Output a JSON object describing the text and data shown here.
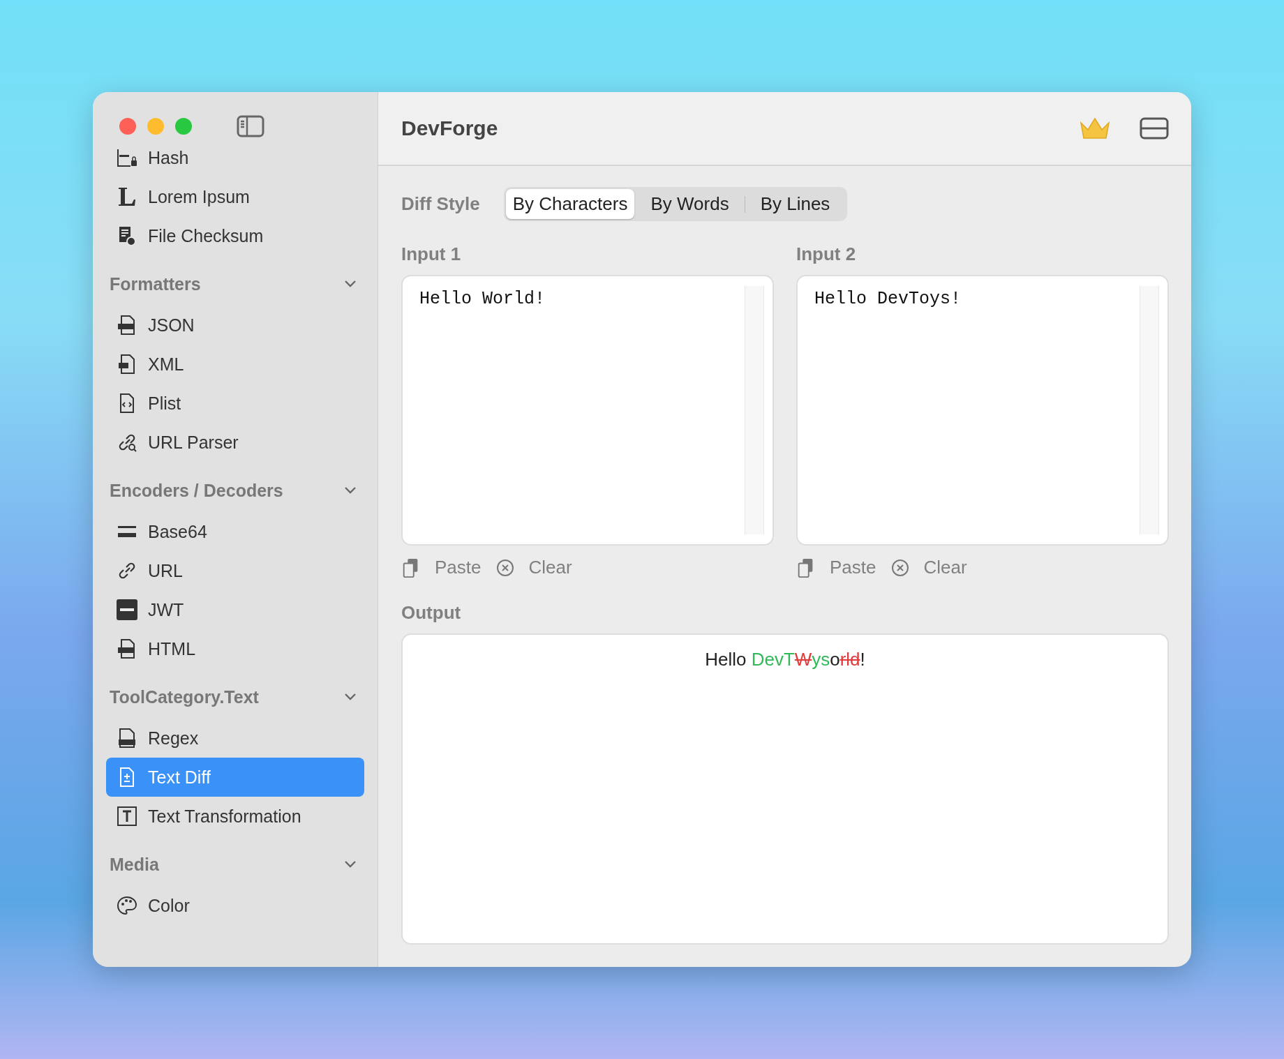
{
  "window": {
    "title": "DevForge"
  },
  "sidebar": {
    "top_items": [
      {
        "label": "Hash",
        "kind": "hash",
        "selected": false
      },
      {
        "label": "Lorem Ipsum",
        "kind": "letter",
        "selected": false
      },
      {
        "label": "File Checksum",
        "kind": "checksum",
        "selected": false
      }
    ],
    "sections": [
      {
        "title": "Formatters",
        "expanded": true,
        "items": [
          {
            "label": "JSON",
            "kind": "json",
            "selected": false
          },
          {
            "label": "XML",
            "kind": "xml",
            "selected": false
          },
          {
            "label": "Plist",
            "kind": "code",
            "selected": false
          },
          {
            "label": "URL Parser",
            "kind": "linksearch",
            "selected": false
          }
        ]
      },
      {
        "title": "Encoders / Decoders",
        "expanded": true,
        "items": [
          {
            "label": "Base64",
            "kind": "base",
            "selected": false
          },
          {
            "label": "URL",
            "kind": "link",
            "selected": false
          },
          {
            "label": "JWT",
            "kind": "jwt",
            "selected": false
          },
          {
            "label": "HTML",
            "kind": "html",
            "selected": false
          }
        ]
      },
      {
        "title": "ToolCategory.Text",
        "expanded": true,
        "items": [
          {
            "label": "Regex",
            "kind": "regex",
            "selected": false
          },
          {
            "label": "Text Diff",
            "kind": "diff",
            "selected": true
          },
          {
            "label": "Text Transformation",
            "kind": "textbox",
            "selected": false
          }
        ]
      },
      {
        "title": "Media",
        "expanded": true,
        "items": [
          {
            "label": "Color",
            "kind": "palette",
            "selected": false
          }
        ]
      }
    ]
  },
  "diff_style": {
    "label": "Diff Style",
    "options": [
      {
        "label": "By Characters",
        "selected": true
      },
      {
        "label": "By Words",
        "selected": false
      },
      {
        "label": "By Lines",
        "selected": false
      }
    ]
  },
  "inputs": [
    {
      "label": "Input 1",
      "value": "Hello World!",
      "paste": "Paste",
      "clear": "Clear"
    },
    {
      "label": "Input 2",
      "value": "Hello DevToys!",
      "paste": "Paste",
      "clear": "Clear"
    }
  ],
  "output": {
    "label": "Output",
    "segments": [
      {
        "text": "Hello ",
        "kind": "equal"
      },
      {
        "text": "DevT",
        "kind": "insert"
      },
      {
        "text": "W",
        "kind": "delete"
      },
      {
        "text": "ys",
        "kind": "insert"
      },
      {
        "text": "o",
        "kind": "equal"
      },
      {
        "text": "rld",
        "kind": "delete"
      },
      {
        "text": "!",
        "kind": "equal"
      }
    ]
  }
}
